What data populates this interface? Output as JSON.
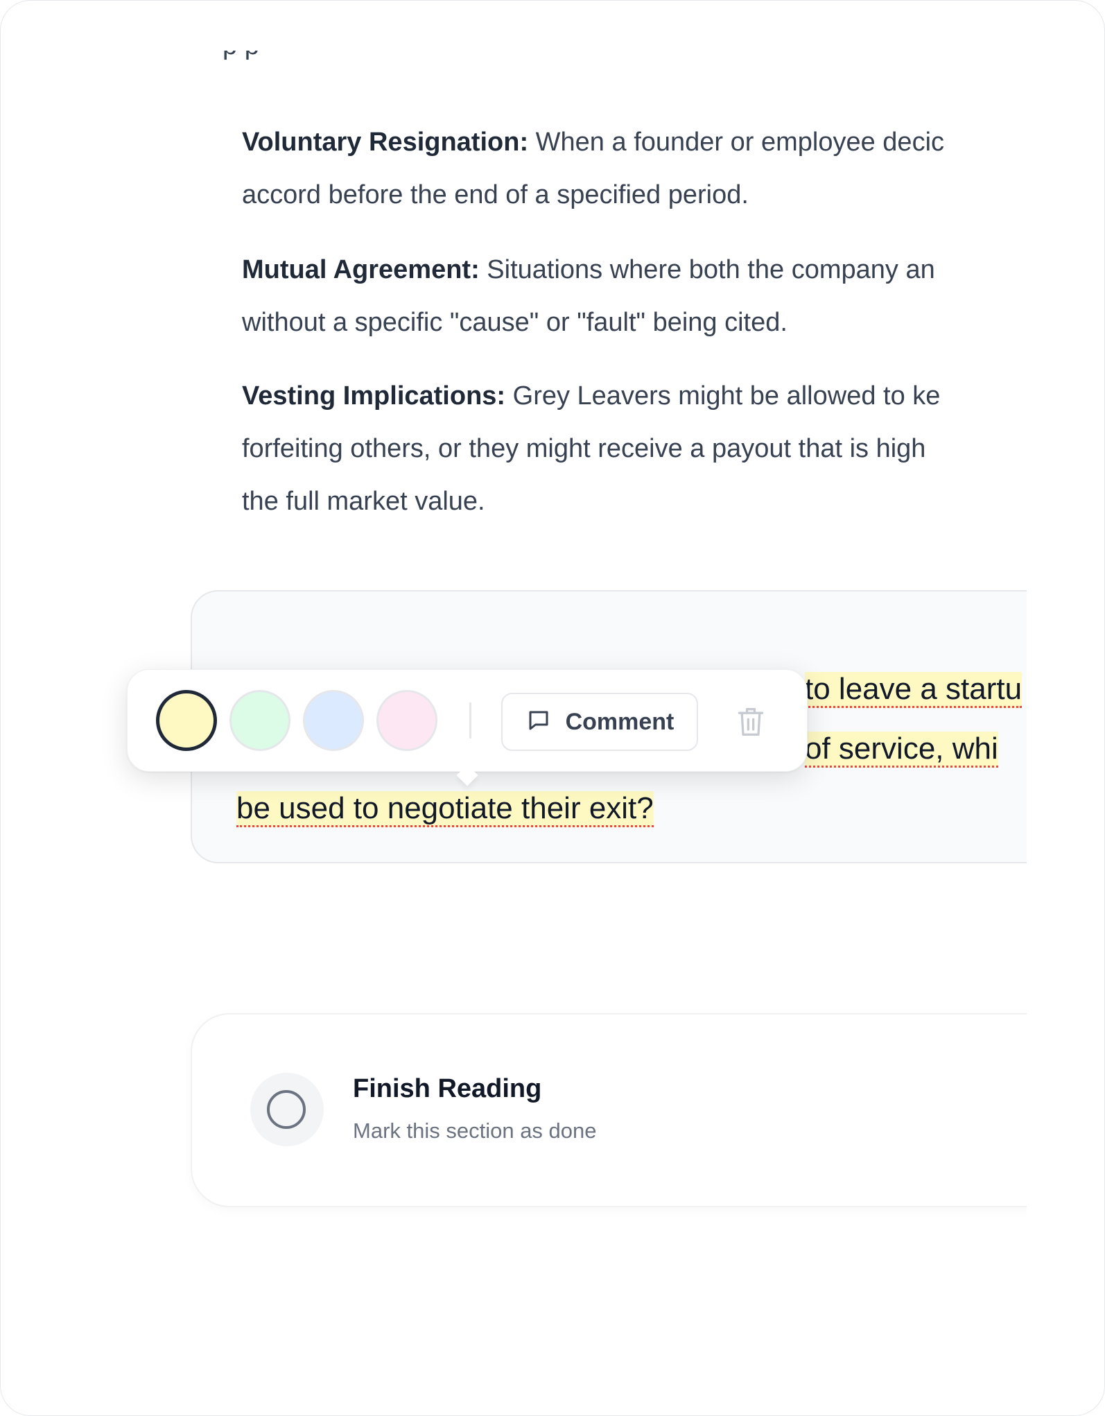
{
  "content": {
    "paragraphs": [
      {
        "term": "Voluntary Resignation:",
        "lines": [
          "When a founder or employee decic",
          "accord before the end of a specified period."
        ]
      },
      {
        "term": "Mutual Agreement:",
        "lines": [
          "Situations where both the company an",
          "without a specific \"cause\" or \"fault\" being cited."
        ]
      },
      {
        "term": "Vesting Implications:",
        "lines": [
          "Grey Leavers might be allowed to ke",
          "forfeiting others, or they might receive a payout that is high",
          "the full market value."
        ]
      }
    ]
  },
  "quote": {
    "line1": "to leave a startu",
    "line2": "of service, whi",
    "line3": "be used to negotiate their exit?"
  },
  "toolbar": {
    "swatches": [
      {
        "name": "yellow",
        "color": "#fef9c3",
        "selected": true
      },
      {
        "name": "green",
        "color": "#dcfce7",
        "selected": false
      },
      {
        "name": "blue",
        "color": "#dbeafe",
        "selected": false
      },
      {
        "name": "pink",
        "color": "#fce7f3",
        "selected": false
      }
    ],
    "comment_label": "Comment",
    "comment_icon": "message-square-icon",
    "delete_icon": "trash-icon"
  },
  "finish": {
    "title": "Finish Reading",
    "subtitle": "Mark this section as done",
    "icon": "circle-icon"
  }
}
